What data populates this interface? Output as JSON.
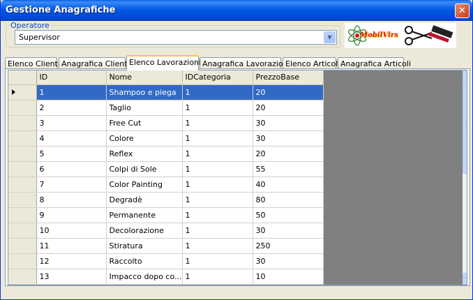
{
  "window": {
    "title": "Gestione Anagrafiche",
    "close_icon": "close-icon"
  },
  "operatore": {
    "legend": "Operatore",
    "selected": "Supervisor"
  },
  "logo": {
    "text": "MobilVirs"
  },
  "tabs": [
    {
      "label": "Elenco Clienti",
      "active": false
    },
    {
      "label": "Anagrafica Cliente",
      "active": false
    },
    {
      "label": "Elenco Lavorazioni",
      "active": true
    },
    {
      "label": "Anagrafica Lavorazioni",
      "active": false
    },
    {
      "label": "Elenco Articoli",
      "active": false
    },
    {
      "label": "Anagrafica Articoli",
      "active": false
    }
  ],
  "grid": {
    "columns": [
      "ID",
      "Nome",
      "IDCategoria",
      "PrezzoBase"
    ],
    "selected_row": 0,
    "rows": [
      [
        "1",
        "Shampoo e piega",
        "1",
        "20"
      ],
      [
        "2",
        "Taglio",
        "1",
        "20"
      ],
      [
        "3",
        "Free Cut",
        "1",
        "30"
      ],
      [
        "4",
        "Colore",
        "1",
        "30"
      ],
      [
        "5",
        "Reflex",
        "1",
        "20"
      ],
      [
        "6",
        "Colpi di Sole",
        "1",
        "55"
      ],
      [
        "7",
        "Color Painting",
        "1",
        "40"
      ],
      [
        "8",
        "Degradè",
        "1",
        "80"
      ],
      [
        "9",
        "Permanente",
        "1",
        "50"
      ],
      [
        "10",
        "Decolorazione",
        "1",
        "30"
      ],
      [
        "11",
        "Stiratura",
        "1",
        "250"
      ],
      [
        "12",
        "Raccolto",
        "1",
        "30"
      ],
      [
        "13",
        "Impacco dopo co...",
        "1",
        "10"
      ]
    ]
  }
}
